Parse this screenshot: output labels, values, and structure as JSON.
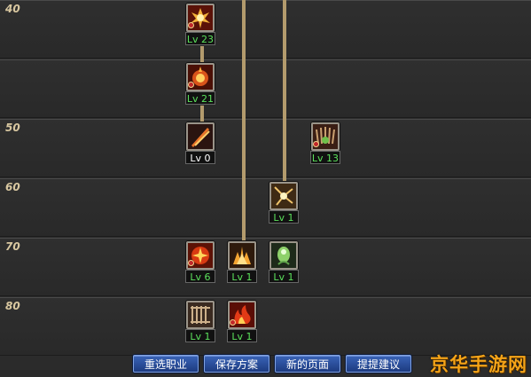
{
  "level_rows": [
    "40",
    "",
    "50",
    "60",
    "70",
    "80"
  ],
  "skills": [
    {
      "name": "skill-40-flame-burst",
      "level": "Lv 23",
      "color": "green",
      "icon": "flame-burst-icon"
    },
    {
      "name": "skill-45-explosion",
      "level": "Lv 21",
      "color": "green",
      "icon": "explosion-icon"
    },
    {
      "name": "skill-50-fire-slash",
      "level": "Lv 0",
      "color": "white",
      "icon": "fire-slash-icon"
    },
    {
      "name": "skill-50-summon",
      "level": "Lv 13",
      "color": "green",
      "icon": "summon-icon"
    },
    {
      "name": "skill-60-shockwave",
      "level": "Lv 1",
      "color": "green",
      "icon": "shockwave-icon"
    },
    {
      "name": "skill-70-nova",
      "level": "Lv 6",
      "color": "green",
      "icon": "nova-icon"
    },
    {
      "name": "skill-70-eruption",
      "level": "Lv 1",
      "color": "green",
      "icon": "eruption-icon"
    },
    {
      "name": "skill-70-spirit",
      "level": "Lv 1",
      "color": "green",
      "icon": "spirit-icon"
    },
    {
      "name": "skill-80-cage",
      "level": "Lv 1",
      "color": "green",
      "icon": "cage-icon"
    },
    {
      "name": "skill-80-inferno",
      "level": "Lv 1",
      "color": "green",
      "icon": "inferno-icon"
    }
  ],
  "buttons": {
    "reselect": "重选职业",
    "save": "保存方案",
    "new_page": "新的页面",
    "suggest": "提提建议"
  },
  "watermark": "京华手游网",
  "colors": {
    "level_green": "#5be05b",
    "connector": "#b39b6d",
    "button_blue": "#2a4f9e",
    "watermark": "#f5a418"
  }
}
